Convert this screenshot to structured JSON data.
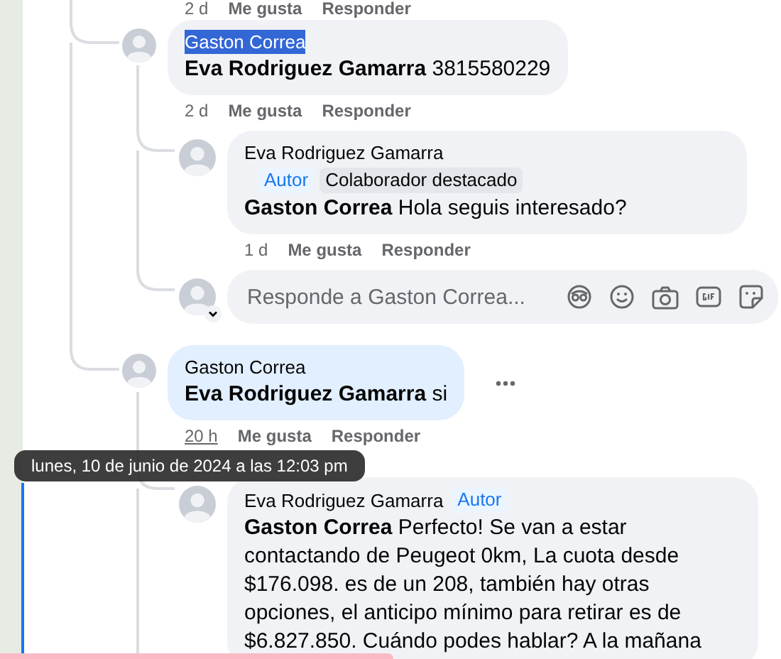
{
  "previous_actions": {
    "time": "2 d",
    "actions": [
      "Me gusta",
      "Responder"
    ]
  },
  "comments": [
    {
      "author": "Gaston Correa",
      "author_selected": true,
      "text": "**Eva Rodriguez Gamarra** 3815580229",
      "highlighted": false,
      "more_button": false,
      "time": "2 d",
      "time_hovered": false,
      "actions": [
        "Me gusta",
        "Responder"
      ],
      "children": [
        {
          "author": "Eva Rodriguez Gamarra",
          "badges": [
            {
              "label": "Autor",
              "kind": "author"
            },
            {
              "label": "Colaborador destacado",
              "kind": "contributor"
            }
          ],
          "text": "**Gaston Correa** Hola seguis interesado?",
          "time": "1 d",
          "actions": [
            "Me gusta",
            "Responder"
          ]
        }
      ],
      "composer": {
        "placeholder": "Responde a Gaston Correa..."
      }
    },
    {
      "author": "Gaston Correa",
      "author_selected": false,
      "text": "**Eva Rodriguez Gamarra** si",
      "highlighted": true,
      "more_button": true,
      "time": "20 h",
      "time_hovered": true,
      "actions": [
        "Me gusta",
        "Responder"
      ],
      "children": [
        {
          "author": "Eva Rodriguez Gamarra",
          "badges": [
            {
              "label": "Autor",
              "kind": "author"
            }
          ],
          "text": "**Gaston Correa** Perfecto! Se van a estar contactando de Peugeot 0km, La cuota desde $176.098. es de un 208, también hay otras opciones, el anticipo mínimo para retirar es de $6.827.850. Cuándo podes hablar? A la mañana"
        }
      ]
    }
  ],
  "tooltip": {
    "text": "lunes, 10 de junio de 2024 a las 12:03 pm"
  }
}
